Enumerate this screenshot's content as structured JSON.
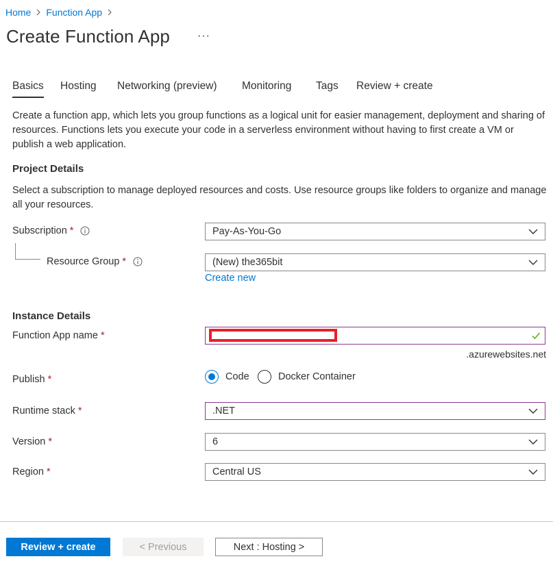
{
  "breadcrumb": {
    "home": "Home",
    "function_app": "Function App"
  },
  "page": {
    "title": "Create Function App",
    "more": "···"
  },
  "tabs": [
    {
      "label": "Basics",
      "active": true
    },
    {
      "label": "Hosting"
    },
    {
      "label": "Networking (preview)"
    },
    {
      "label": "Monitoring"
    },
    {
      "label": "Tags"
    },
    {
      "label": "Review + create"
    }
  ],
  "intro": "Create a function app, which lets you group functions as a logical unit for easier management, deployment and sharing of resources. Functions lets you execute your code in a serverless environment without having to first create a VM or publish a web application.",
  "project": {
    "heading": "Project Details",
    "description": "Select a subscription to manage deployed resources and costs. Use resource groups like folders to organize and manage all your resources.",
    "subscription_label": "Subscription",
    "subscription_value": "Pay-As-You-Go",
    "resource_group_label": "Resource Group",
    "resource_group_value": "(New) the365bit",
    "create_new": "Create new"
  },
  "instance": {
    "heading": "Instance Details",
    "name_label": "Function App name",
    "name_suffix": ".azurewebsites.net",
    "publish_label": "Publish",
    "publish_options": [
      {
        "label": "Code",
        "selected": true
      },
      {
        "label": "Docker Container",
        "selected": false
      }
    ],
    "runtime_label": "Runtime stack",
    "runtime_value": ".NET",
    "version_label": "Version",
    "version_value": "6",
    "region_label": "Region",
    "region_value": "Central US"
  },
  "required_mark": "*",
  "footer": {
    "review_create": "Review + create",
    "previous": "< Previous",
    "next": "Next : Hosting >"
  },
  "colors": {
    "accent": "#0078d4",
    "required": "#a4262c",
    "focus_border": "#8a3a8f",
    "valid": "#57a300",
    "redaction": "#e8202a"
  }
}
